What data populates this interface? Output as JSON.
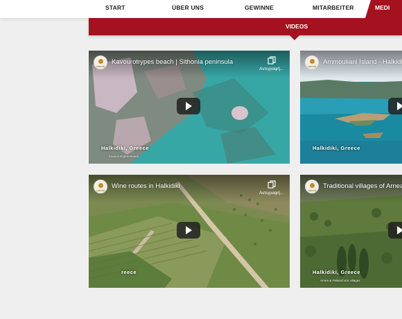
{
  "nav": {
    "items": [
      "START",
      "ÜBER UNS",
      "GEWINNE",
      "MITARBEITER"
    ],
    "active": "MEDI"
  },
  "subnav": {
    "label": "VIDEOS"
  },
  "channel_logo_text": "halkidiki",
  "videos": [
    {
      "title": "Kavourotrypes beach | Sithonia peninsula",
      "share_label": "Αντιγραφή...",
      "caption": "Halkidiki, Greece",
      "subcaption": "Kavourotrypes Beach"
    },
    {
      "title": "Ammouliani Island - Halkidi",
      "share_label": "",
      "caption": "Halkidiki, Greece",
      "subcaption": ""
    },
    {
      "title": "Wine routes in Halkidiki",
      "share_label": "Αντιγραφή...",
      "caption": "reece",
      "subcaption": ""
    },
    {
      "title": "Traditional villages of Arnea",
      "share_label": "",
      "caption": "Halkidiki, Greece",
      "subcaption": "Arnea & Palaiochora villages"
    }
  ],
  "colors": {
    "accent": "#a3121e",
    "background": "#efefef"
  }
}
